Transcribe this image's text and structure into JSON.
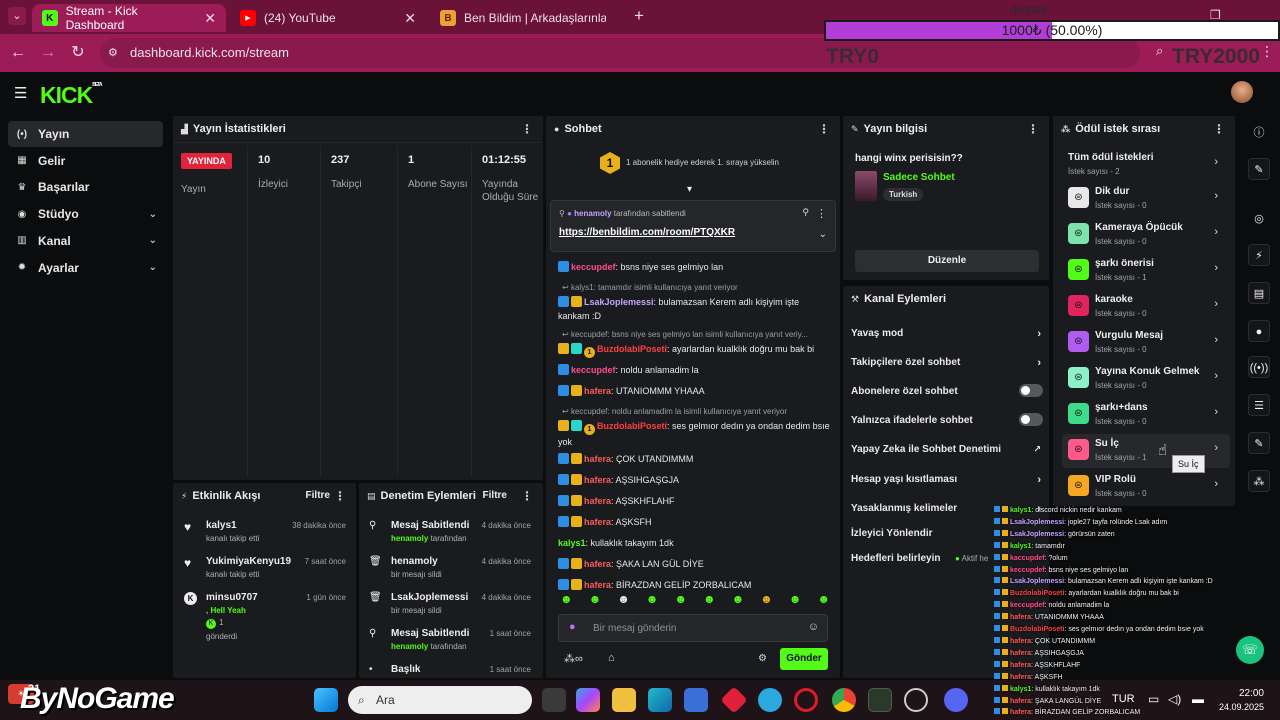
{
  "browser": {
    "tabs": [
      {
        "title": "Stream - Kick Dashboard",
        "active": true
      },
      {
        "title": "(24) YouTube",
        "active": false
      },
      {
        "title": "Ben Bildim | Arkadaşlarınla Onl",
        "active": false
      }
    ],
    "new_tab": "+",
    "url": "dashboard.kick.com/stream"
  },
  "donation": {
    "title": "destek",
    "current": "1000₺",
    "percent_text": "(50.00%)",
    "progress": 0.5,
    "min_label": "TRY0",
    "max_label": "TRY2000"
  },
  "logo": {
    "text": "KICK",
    "badge": "BETA"
  },
  "sidebar": {
    "items": [
      {
        "label": "Yayın",
        "icon": "broadcast-icon",
        "glyph": "(•)",
        "active": true,
        "expand": false
      },
      {
        "label": "Gelir",
        "icon": "revenue-icon",
        "glyph": "▦",
        "active": false,
        "expand": false
      },
      {
        "label": "Başarılar",
        "icon": "trophy-icon",
        "glyph": "♛",
        "active": false,
        "expand": false
      },
      {
        "label": "Stüdyo",
        "icon": "studio-icon",
        "glyph": "◉",
        "active": false,
        "expand": true
      },
      {
        "label": "Kanal",
        "icon": "channel-icon",
        "glyph": "▥",
        "active": false,
        "expand": true
      },
      {
        "label": "Ayarlar",
        "icon": "settings-icon",
        "glyph": "✹",
        "active": false,
        "expand": true
      }
    ]
  },
  "stats": {
    "title": "Yayın İstatistikleri",
    "live_badge": "YAYINDA",
    "live_label": "Yayın",
    "columns": [
      {
        "value": "10",
        "label": "İzleyici"
      },
      {
        "value": "237",
        "label": "Takipçi"
      },
      {
        "value": "1",
        "label": "Abone Sayısı"
      },
      {
        "value": "01:12:55",
        "label": "Yayında Olduğu Süre"
      }
    ]
  },
  "chat": {
    "title": "Sohbet",
    "goal_number": "1",
    "goal_text": "1 abonelik hediye ederek 1. sıraya yükselin",
    "pinned": {
      "by": "henamoly",
      "suffix": "tarafından sabitlendi",
      "link": "https://benbildim.com/room/PTQXKR"
    },
    "messages": [
      {
        "reply": "",
        "badges": [
          "blue"
        ],
        "user": "keccupdef",
        "color": "#ff4d8d",
        "text": ": bsns niye ses gelmiyo lan"
      },
      {
        "reply": "kalys1: tamamdır isimli kullanıcıya yanıt veriyor",
        "badges": [
          "blue",
          "gold"
        ],
        "user": "LsakJoplemessi",
        "color": "#c9a3ff",
        "text": ": bulamazsan Kerem adlı kişiyim işte kankam :D"
      },
      {
        "reply": "keccupdef: bsns niye ses gelmiyo lan isimli kullanıcıya yanıt veriy...",
        "badges": [
          "gold",
          "cyan",
          "num"
        ],
        "user": "BuzdolabiPoseti",
        "color": "#ff4040",
        "text": ": ayarlardan kualklık doğru mu bak bi"
      },
      {
        "reply": "",
        "badges": [
          "blue"
        ],
        "user": "keccupdef",
        "color": "#ff4d8d",
        "text": ": noldu anlamadim la"
      },
      {
        "reply": "",
        "badges": [
          "blue",
          "gold"
        ],
        "user": "hafera",
        "color": "#ff5a5a",
        "text": ": UTANIOMMM YHAAA"
      },
      {
        "reply": "keccupdef: noldu anlamadim la isimli kullanıcıya yanıt veriyor",
        "badges": [
          "gold",
          "cyan",
          "num"
        ],
        "user": "BuzdolabiPoseti",
        "color": "#ff4040",
        "text": ": ses gelmıor dedın ya ondan dedim bsıe yok"
      },
      {
        "reply": "",
        "badges": [
          "blue",
          "gold"
        ],
        "user": "hafera",
        "color": "#ff5a5a",
        "text": ": ÇOK UTANDIMMM"
      },
      {
        "reply": "",
        "badges": [
          "blue",
          "gold"
        ],
        "user": "hafera",
        "color": "#ff5a5a",
        "text": ": AŞSIHGAŞGJA"
      },
      {
        "reply": "",
        "badges": [
          "blue",
          "gold"
        ],
        "user": "hafera",
        "color": "#ff5a5a",
        "text": ": AŞSKHFLAHF"
      },
      {
        "reply": "",
        "badges": [
          "blue",
          "gold"
        ],
        "user": "hafera",
        "color": "#ff5a5a",
        "text": ": AŞKSFH"
      },
      {
        "reply": "",
        "badges": [],
        "user": "kalys1",
        "color": "#53fc18",
        "text": ": kullaklık takayım 1dk"
      },
      {
        "reply": "",
        "badges": [
          "blue",
          "gold"
        ],
        "user": "hafera",
        "color": "#ff5a5a",
        "text": ": ŞAKA LAN GÜL DİYE"
      },
      {
        "reply": "",
        "badges": [
          "blue",
          "gold"
        ],
        "user": "hafera",
        "color": "#ff5a5a",
        "text": ": BİRAZDAN GELİP ZORBALICAM"
      }
    ],
    "input_placeholder": "Bir mesaj gönderin",
    "send_label": "Gönder"
  },
  "stream_info": {
    "title": "Yayın bilgisi",
    "stream_title": "hangi winx perisisin??",
    "category": "Sadece Sohbet",
    "tag": "Turkish",
    "edit_label": "Düzenle"
  },
  "channel_actions": {
    "title": "Kanal Eylemleri",
    "items": [
      {
        "label": "Yavaş mod",
        "control": "chevron"
      },
      {
        "label": "Takipçilere özel sohbet",
        "control": "chevron"
      },
      {
        "label": "Abonelere özel sohbet",
        "control": "toggle"
      },
      {
        "label": "Yalnızca ifadelerle sohbet",
        "control": "toggle"
      },
      {
        "label": "Yapay Zeka ile Sohbet Denetimi",
        "control": "external"
      },
      {
        "label": "Hesap yaşı kısıtlaması",
        "control": "chevron"
      },
      {
        "label": "Yasaklanmış kelimeler",
        "control": "chevron"
      },
      {
        "label": "İzleyici Yönlendir",
        "control": "none"
      },
      {
        "label": "Hedefleri belirleyin",
        "control": "status"
      }
    ],
    "status_text": "Aktif he"
  },
  "rewards": {
    "title": "Ödül istek sırası",
    "all_label": "Tüm ödül istekleri",
    "all_count": "İstek sayısı - 2",
    "items": [
      {
        "name": "Dik dur",
        "count": "İstek sayısı - 0",
        "color": "#e8e8e8"
      },
      {
        "name": "Kameraya Öpücük",
        "count": "İstek sayısı - 0",
        "color": "#7ce3a9"
      },
      {
        "name": "şarkı önerisi",
        "count": "İstek sayısı - 1",
        "color": "#53fc18"
      },
      {
        "name": "karaoke",
        "count": "İstek sayısı - 0",
        "color": "#e0245e"
      },
      {
        "name": "Vurgulu Mesaj",
        "count": "İstek sayısı - 0",
        "color": "#b05cf0"
      },
      {
        "name": "Yayına Konuk Gelmek",
        "count": "İstek sayısı - 0",
        "color": "#8ef0c8"
      },
      {
        "name": "şarkı+dans",
        "count": "İstek sayısı - 0",
        "color": "#3ddc8a"
      },
      {
        "name": "Su İç",
        "count": "İstek sayısı - 1",
        "color": "#ff5a8a"
      },
      {
        "name": "VIP Rolü",
        "count": "İstek sayısı - 0",
        "color": "#f5a623"
      }
    ],
    "tooltip": "Su İç"
  },
  "activity": {
    "title": "Etkinlik Akışı",
    "filter": "Filtre",
    "events": [
      {
        "icon": "heart-icon",
        "glyph": "♥",
        "name": "kalys1",
        "sub": "kanalı takip etti",
        "time": "38 dakika önce"
      },
      {
        "icon": "heart-icon",
        "glyph": "♥",
        "name": "YukimiyaKenyu19",
        "sub": "kanalı takip etti",
        "time": "7 saat önce"
      },
      {
        "icon": "kick-coin-icon",
        "glyph": "K",
        "name": "minsu0707",
        "sub": ", Hell Yeah",
        "extra": "1",
        "sub2": "gönderdi",
        "time": "1 gün önce"
      }
    ]
  },
  "moderation": {
    "title": "Denetim Eylemleri",
    "filter": "Filtre",
    "events": [
      {
        "icon": "pin-icon",
        "glyph": "⚲",
        "name": "Mesaj Sabitlendi",
        "by": "henamoly",
        "suffix": "tarafından",
        "time": "4 dakika önce"
      },
      {
        "icon": "trash-icon",
        "glyph": "🗑",
        "name": "henamoly",
        "by": "",
        "suffix": "bir mesajı sildi",
        "time": "4 dakika önce"
      },
      {
        "icon": "trash-icon",
        "glyph": "🗑",
        "name": "LsakJoplemessi",
        "by": "",
        "suffix": "bir mesajı sildi",
        "time": "4 dakika önce"
      },
      {
        "icon": "pin-icon",
        "glyph": "⚲",
        "name": "Mesaj Sabitlendi",
        "by": "henamoly",
        "suffix": "tarafından",
        "time": "1 saat önce"
      },
      {
        "icon": "title-icon",
        "glyph": "•",
        "name": "Başlık",
        "by": "",
        "suffix": "",
        "time": "1 saat önce"
      }
    ]
  },
  "taskbar": {
    "weather_temp": "21",
    "search": "Ara",
    "lang": "TUR",
    "time": "22:00",
    "date": "24.09.2025",
    "watermark": "ByNoGame"
  },
  "overlay_chat": [
    {
      "user": "kalys1",
      "color": "#53fc18",
      "text": ": discord nickin nedir kankam"
    },
    {
      "user": "LsakJoplemessi",
      "color": "#c9a3ff",
      "text": ": jople27 tayfa rolünde Lsak adım"
    },
    {
      "user": "LsakJoplemessi",
      "color": "#c9a3ff",
      "text": ": görürsün zaten"
    },
    {
      "user": "kalys1",
      "color": "#53fc18",
      "text": ": tamamdır"
    },
    {
      "user": "kaccupdef",
      "color": "#ff4d8d",
      "text": ": ?olum"
    },
    {
      "user": "keccupdef",
      "color": "#ff4d8d",
      "text": ": bsns niye ses gelmiyo lan"
    },
    {
      "user": "LsakJoplemessi",
      "color": "#c9a3ff",
      "text": ": bulamazsan Kerem adlı kişiyim işte kankam :D"
    },
    {
      "user": "BuzdolabiPoseti",
      "color": "#ff4040",
      "text": ": ayarlardan kualklık doğru mu bak bi"
    },
    {
      "user": "keccupdef",
      "color": "#ff4d8d",
      "text": ": noldu anlamadim la"
    },
    {
      "user": "hafera",
      "color": "#ff5a5a",
      "text": ": UTANIOMMM YHAAA"
    },
    {
      "user": "BuzdolabiPoseti",
      "color": "#ff4040",
      "text": ": ses gelmıor dedın ya ondan dedim bsıe yok"
    },
    {
      "user": "hafera",
      "color": "#ff5a5a",
      "text": ": ÇOK UTANDIMMM"
    },
    {
      "user": "hafera",
      "color": "#ff5a5a",
      "text": ": AŞSIHGAŞGJA"
    },
    {
      "user": "hafera",
      "color": "#ff5a5a",
      "text": ": AŞSKHFLAHF"
    },
    {
      "user": "hafera",
      "color": "#ff5a5a",
      "text": ": AŞKSFH"
    },
    {
      "user": "kalys1",
      "color": "#53fc18",
      "text": ": kullaklık takayım 1dk"
    },
    {
      "user": "hafera",
      "color": "#ff5a5a",
      "text": ": ŞAKA LANGÜL DİYE"
    },
    {
      "user": "hafera",
      "color": "#ff5a5a",
      "text": ": BİRAZDAN GELİP ZORBALICAM"
    }
  ]
}
